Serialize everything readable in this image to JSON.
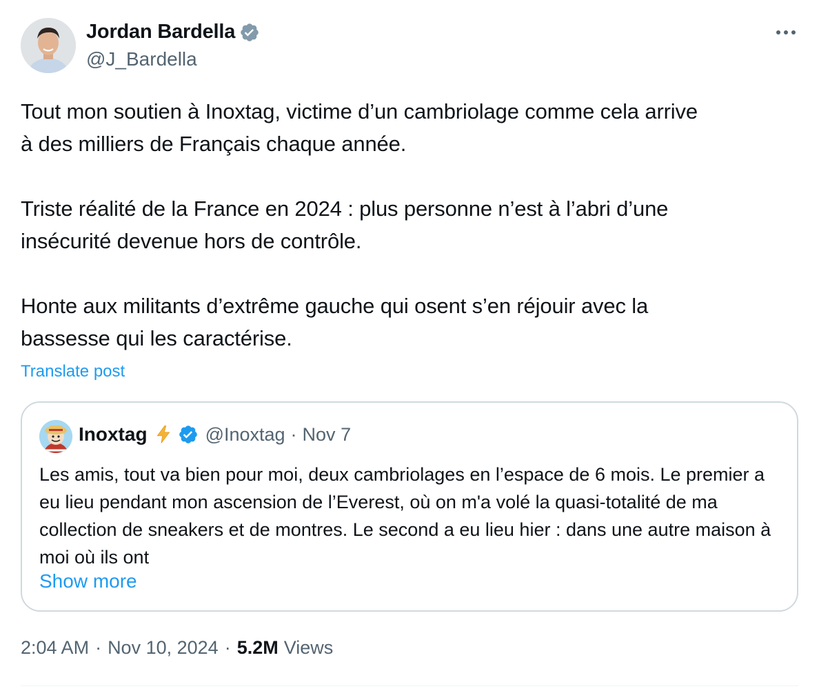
{
  "author": {
    "display_name": "Jordan Bardella",
    "handle": "@J_Bardella",
    "verified_icon": "verified-badge-gray",
    "verified_color": "#829aab"
  },
  "post": {
    "text": "Tout mon soutien à Inoxtag, victime d’un cambriolage comme cela arrive\nà des milliers de Français chaque année.\n\nTriste réalité de la France en 2024 : plus personne n’est à l’abri d’une\ninsécurité devenue hors de contrôle.\n\nHonte aux militants d’extrême gauche qui osent s’en réjouir avec la\nbassesse qui les caractérise.",
    "translate_label": "Translate post"
  },
  "quoted_post": {
    "display_name": "Inoxtag",
    "emoji_icon": "lightning-bolt-icon",
    "verified_icon": "verified-badge-blue",
    "verified_color": "#1d9bf0",
    "handle": "@Inoxtag",
    "separator": "·",
    "date": "Nov 7",
    "text": "Les amis, tout va bien pour moi, deux cambriolages en l’espace de 6 mois. Le premier a eu lieu pendant mon ascension de l’Everest, où on m'a volé la quasi-totalité de ma collection de sneakers et de montres. Le second a eu lieu hier : dans une autre maison à moi où ils ont",
    "show_more_label": "Show more"
  },
  "meta": {
    "time": "2:04 AM",
    "separator": "·",
    "date": "Nov 10, 2024",
    "views_count": "5.2M",
    "views_label": "Views"
  },
  "colors": {
    "link": "#1d9bf0",
    "secondary_text": "#536471",
    "border": "#cfd9de"
  }
}
